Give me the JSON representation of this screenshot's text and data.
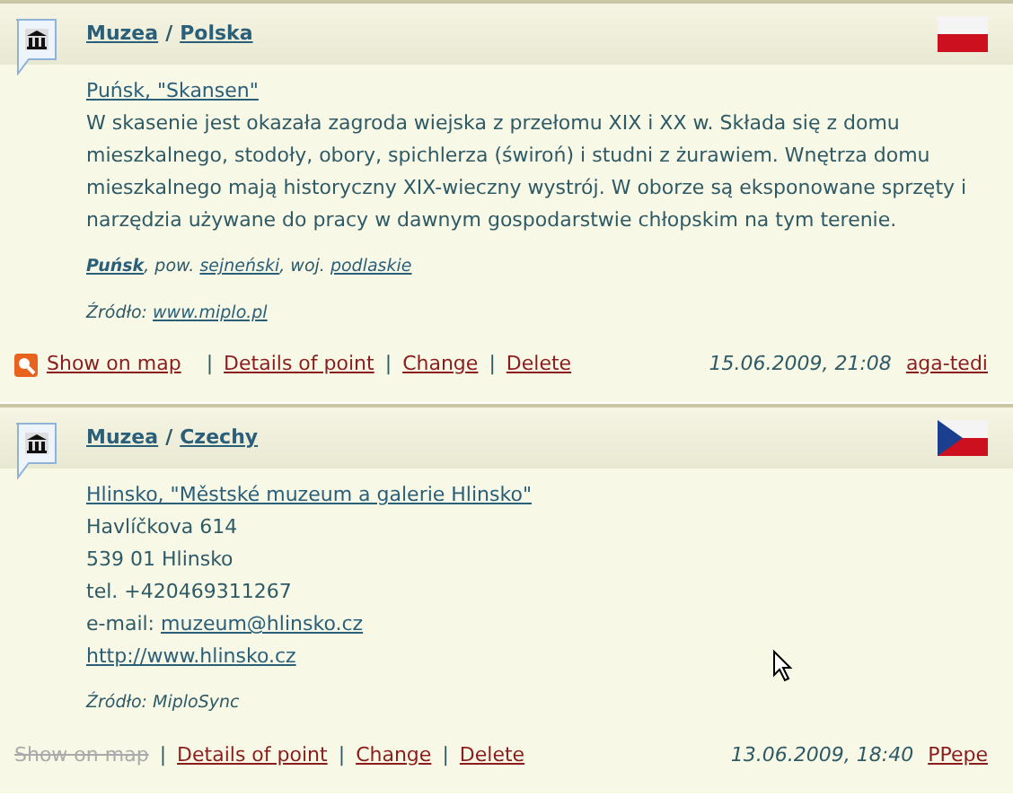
{
  "entries": [
    {
      "category": "Muzea",
      "breadcrumb_separator": "/",
      "country": "Polska",
      "flag": {
        "kind": "pl"
      },
      "title": "Puńsk, \"Skansen\"",
      "lines": [
        [
          {
            "text": "W skasenie jest okazała zagroda wiejska z przełomu XIX i XX w. Składa się z domu mieszkalnego, stodoły, obory, spichlerza (świroń) i studni z żurawiem. Wnętrza domu mieszkalnego mają historyczny XIX-wieczny wystrój. W oborze są eksponowane sprzęty i narzędzia używane do pracy w dawnym gospodarstwie chłopskim na tym terenie.",
            "kind": "text"
          }
        ]
      ],
      "location": [
        {
          "text": "Puńsk",
          "kind": "bold_link"
        },
        {
          "text": ", pow. ",
          "kind": "text"
        },
        {
          "text": "sejneński",
          "kind": "link"
        },
        {
          "text": ", woj. ",
          "kind": "text"
        },
        {
          "text": "podlaskie",
          "kind": "link"
        }
      ],
      "source": {
        "label": "Źródło:",
        "value": "www.miplo.pl",
        "kind": "link"
      },
      "show_on_map": {
        "label": "Show on map",
        "disabled": false
      },
      "actions": [
        {
          "separator": "|",
          "label": "Details of point"
        },
        {
          "separator": "|",
          "label": "Change"
        },
        {
          "separator": "|",
          "label": "Delete"
        }
      ],
      "date": "15.06.2009, 21:08",
      "user": "aga-tedi"
    },
    {
      "category": "Muzea",
      "breadcrumb_separator": "/",
      "country": "Czechy",
      "flag": {
        "kind": "cz"
      },
      "title": "Hlinsko, \"Městské muzeum a galerie Hlinsko\"",
      "lines": [
        [
          {
            "text": "Havlíčkova 614",
            "kind": "text"
          }
        ],
        [
          {
            "text": "539 01 Hlinsko",
            "kind": "text"
          }
        ],
        [
          {
            "text": "tel. +420469311267",
            "kind": "text"
          }
        ],
        [
          {
            "text": "e-mail: ",
            "kind": "text"
          },
          {
            "text": "muzeum@hlinsko.cz",
            "kind": "link"
          }
        ],
        [
          {
            "text": "http://www.hlinsko.cz",
            "kind": "link"
          }
        ]
      ],
      "source": {
        "label": "Źródło:",
        "value": "MiploSync",
        "kind": "text"
      },
      "show_on_map": {
        "label": "Show on map",
        "disabled": true
      },
      "actions": [
        {
          "separator": "|",
          "label": "Details of point"
        },
        {
          "separator": "|",
          "label": "Change"
        },
        {
          "separator": "|",
          "label": "Delete"
        }
      ],
      "date": "13.06.2009, 18:40",
      "user": "PPepe"
    }
  ]
}
